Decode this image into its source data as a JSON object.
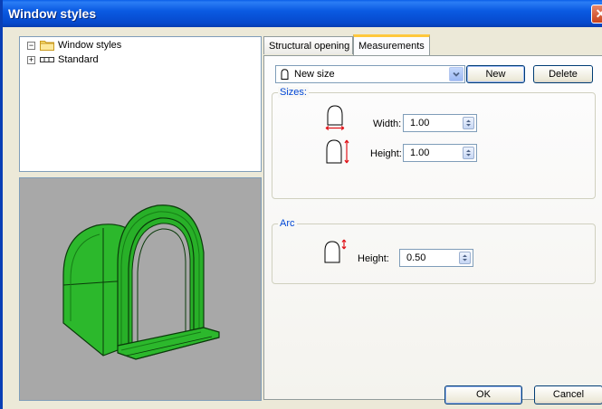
{
  "window": {
    "title": "Window styles",
    "close_glyph": "✕"
  },
  "tree": {
    "root_label": "Window styles",
    "root_expander": "−",
    "child_label": "Standard",
    "child_expander": "+"
  },
  "tabs": [
    {
      "label": "Structural opening",
      "active": false
    },
    {
      "label": "Measurements",
      "active": true
    }
  ],
  "size_select": {
    "value": "New size"
  },
  "buttons": {
    "new": "New",
    "delete": "Delete",
    "ok": "OK",
    "cancel": "Cancel"
  },
  "sizes_group": {
    "label": "Sizes:",
    "width_label": "Width:",
    "width_value": "1.00",
    "height_label": "Height:",
    "height_value": "1.00"
  },
  "arc_group": {
    "label": "Arc",
    "height_label": "Height:",
    "height_value": "0.50"
  },
  "colors": {
    "accent": "#0a5ee8",
    "model": "#1ea51e",
    "arrow": "#e0151b"
  },
  "icons": [
    "close-icon",
    "folder-icon",
    "window-style-icon",
    "arch-window-icon",
    "width-arrow-icon",
    "height-arrow-icon",
    "spin-icon"
  ]
}
